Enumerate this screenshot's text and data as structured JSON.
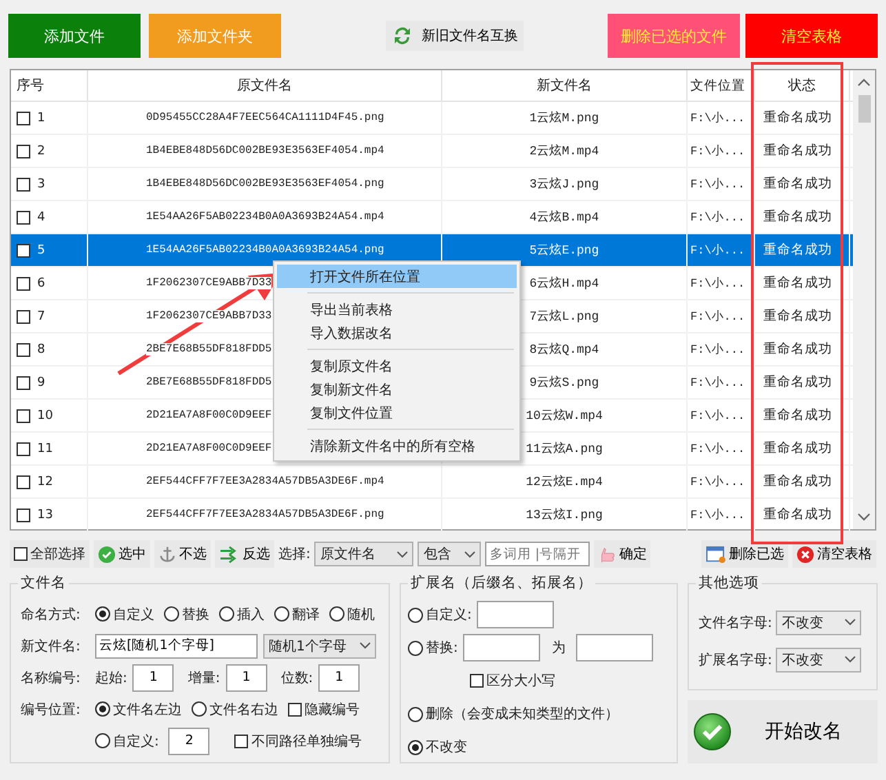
{
  "toolbar": [
    {
      "label": "添加文件",
      "kind": "solid",
      "color": "#0b800b"
    },
    {
      "label": "添加文件夹",
      "kind": "solid",
      "color": "#f29c1f"
    },
    {
      "label": "新旧文件名互换",
      "kind": "swap"
    },
    {
      "label": "删除已选的文件",
      "kind": "warn",
      "color": "#ff5078"
    },
    {
      "label": "清空表格",
      "kind": "warn",
      "color": "#ff0000"
    }
  ],
  "table": {
    "columns": [
      "序号",
      "原文件名",
      "新文件名",
      "文件位置",
      "状态"
    ],
    "rows": [
      {
        "no": "1",
        "checked": false,
        "selected": false,
        "original": "0D95455CC28A4F7EEC564CA1111D4F45.png",
        "new": "1云炫M.png",
        "location": "F:\\小...",
        "status": "重命名成功"
      },
      {
        "no": "2",
        "checked": false,
        "selected": false,
        "original": "1B4EBE848D56DC002BE93E3563EF4054.mp4",
        "new": "2云炫M.mp4",
        "location": "F:\\小...",
        "status": "重命名成功"
      },
      {
        "no": "3",
        "checked": false,
        "selected": false,
        "original": "1B4EBE848D56DC002BE93E3563EF4054.png",
        "new": "3云炫J.png",
        "location": "F:\\小...",
        "status": "重命名成功"
      },
      {
        "no": "4",
        "checked": false,
        "selected": false,
        "original": "1E54AA26F5AB02234B0A0A3693B24A54.mp4",
        "new": "4云炫B.mp4",
        "location": "F:\\小...",
        "status": "重命名成功"
      },
      {
        "no": "5",
        "checked": false,
        "selected": true,
        "original": "1E54AA26F5AB02234B0A0A3693B24A54.png",
        "new": "5云炫E.png",
        "location": "F:\\小...",
        "status": "重命名成功"
      },
      {
        "no": "6",
        "checked": false,
        "selected": false,
        "original": "1F2062307CE9ABB7D33",
        "new": "6云炫H.mp4",
        "location": "F:\\小...",
        "status": "重命名成功"
      },
      {
        "no": "7",
        "checked": false,
        "selected": false,
        "original": "1F2062307CE9ABB7D33",
        "new": "7云炫L.png",
        "location": "F:\\小...",
        "status": "重命名成功"
      },
      {
        "no": "8",
        "checked": false,
        "selected": false,
        "original": "2BE7E68B55DF818FDD5",
        "new": "8云炫Q.mp4",
        "location": "F:\\小...",
        "status": "重命名成功"
      },
      {
        "no": "9",
        "checked": false,
        "selected": false,
        "original": "2BE7E68B55DF818FDD5",
        "new": "9云炫S.png",
        "location": "F:\\小...",
        "status": "重命名成功"
      },
      {
        "no": "10",
        "checked": false,
        "selected": false,
        "original": "2D21EA7A8F00C0D9EEF",
        "new": "10云炫W.mp4",
        "location": "F:\\小...",
        "status": "重命名成功"
      },
      {
        "no": "11",
        "checked": false,
        "selected": false,
        "original": "2D21EA7A8F00C0D9EEF",
        "new": "11云炫A.png",
        "location": "F:\\小...",
        "status": "重命名成功"
      },
      {
        "no": "12",
        "checked": false,
        "selected": false,
        "original": "2EF544CFF7F7EE3A2834A57DB5A3DE6F.mp4",
        "new": "12云炫E.mp4",
        "location": "F:\\小...",
        "status": "重命名成功"
      },
      {
        "no": "13",
        "checked": false,
        "selected": false,
        "original": "2EF544CFF7F7EE3A2834A57DB5A3DE6F.png",
        "new": "13云炫I.png",
        "location": "F:\\小...",
        "status": "重命名成功"
      }
    ]
  },
  "context_menu": {
    "groups": [
      [
        {
          "label": "打开文件所在位置",
          "selected": true
        }
      ],
      [
        {
          "label": "导出当前表格",
          "selected": false
        },
        {
          "label": "导入数据改名",
          "selected": false
        }
      ],
      [
        {
          "label": "复制原文件名",
          "selected": false
        },
        {
          "label": "复制新文件名",
          "selected": false
        },
        {
          "label": "复制文件位置",
          "selected": false
        }
      ],
      [
        {
          "label": "清除新文件名中的所有空格",
          "selected": false
        }
      ]
    ]
  },
  "selection_bar": {
    "select_all": {
      "label": "全部选择",
      "checked": false
    },
    "buttons": [
      {
        "label": "选中",
        "kind": "check"
      },
      {
        "label": "不选",
        "kind": "anchor"
      },
      {
        "label": "反选",
        "kind": "invert"
      }
    ],
    "select_label": "选择:",
    "field_dropdown": "原文件名",
    "match_dropdown": "包含",
    "keyword_placeholder": "多词用 |号隔开",
    "confirm": "确定",
    "delete_selected": "删除已选",
    "clear_table": "清空表格"
  },
  "filename_panel": {
    "title": "文件名",
    "mode_label": "命名方式:",
    "modes": [
      {
        "label": "自定义",
        "selected": true
      },
      {
        "label": "替换",
        "selected": false
      },
      {
        "label": "插入",
        "selected": false
      },
      {
        "label": "翻译",
        "selected": false
      },
      {
        "label": "随机",
        "selected": false
      }
    ],
    "new_name_label": "新文件名:",
    "new_name_value": "云炫[随机1个字母]",
    "insert_dropdown": "随机1个字母",
    "numbering_label": "名称编号:",
    "start_label": "起始:",
    "start_value": "1",
    "step_label": "增量:",
    "step_value": "1",
    "digits_label": "位数:",
    "digits_value": "1",
    "position_label": "编号位置:",
    "positions": [
      {
        "label": "文件名左边",
        "selected": true
      },
      {
        "label": "文件名右边",
        "selected": false
      },
      {
        "label": "自定义:",
        "selected": false
      }
    ],
    "custom_position_value": "2",
    "hide_number": {
      "label": "隐藏编号",
      "checked": false
    },
    "separate_paths": {
      "label": "不同路径单独编号",
      "checked": false
    }
  },
  "extension_panel": {
    "title": "扩展名（后缀名、拓展名）",
    "options": [
      {
        "label": "自定义:",
        "selected": false
      },
      {
        "label": "替换:",
        "selected": false
      },
      {
        "label": "删除（会变成未知类型的文件）",
        "selected": false
      },
      {
        "label": "不改变",
        "selected": true
      }
    ],
    "replace_to_label": "为",
    "case_sensitive": {
      "label": "区分大小写",
      "checked": false
    }
  },
  "other_panel": {
    "title": "其他选项",
    "filename_case_label": "文件名字母:",
    "filename_case": "不改变",
    "ext_case_label": "扩展名字母:",
    "ext_case": "不改变"
  },
  "start_button": "开始改名"
}
